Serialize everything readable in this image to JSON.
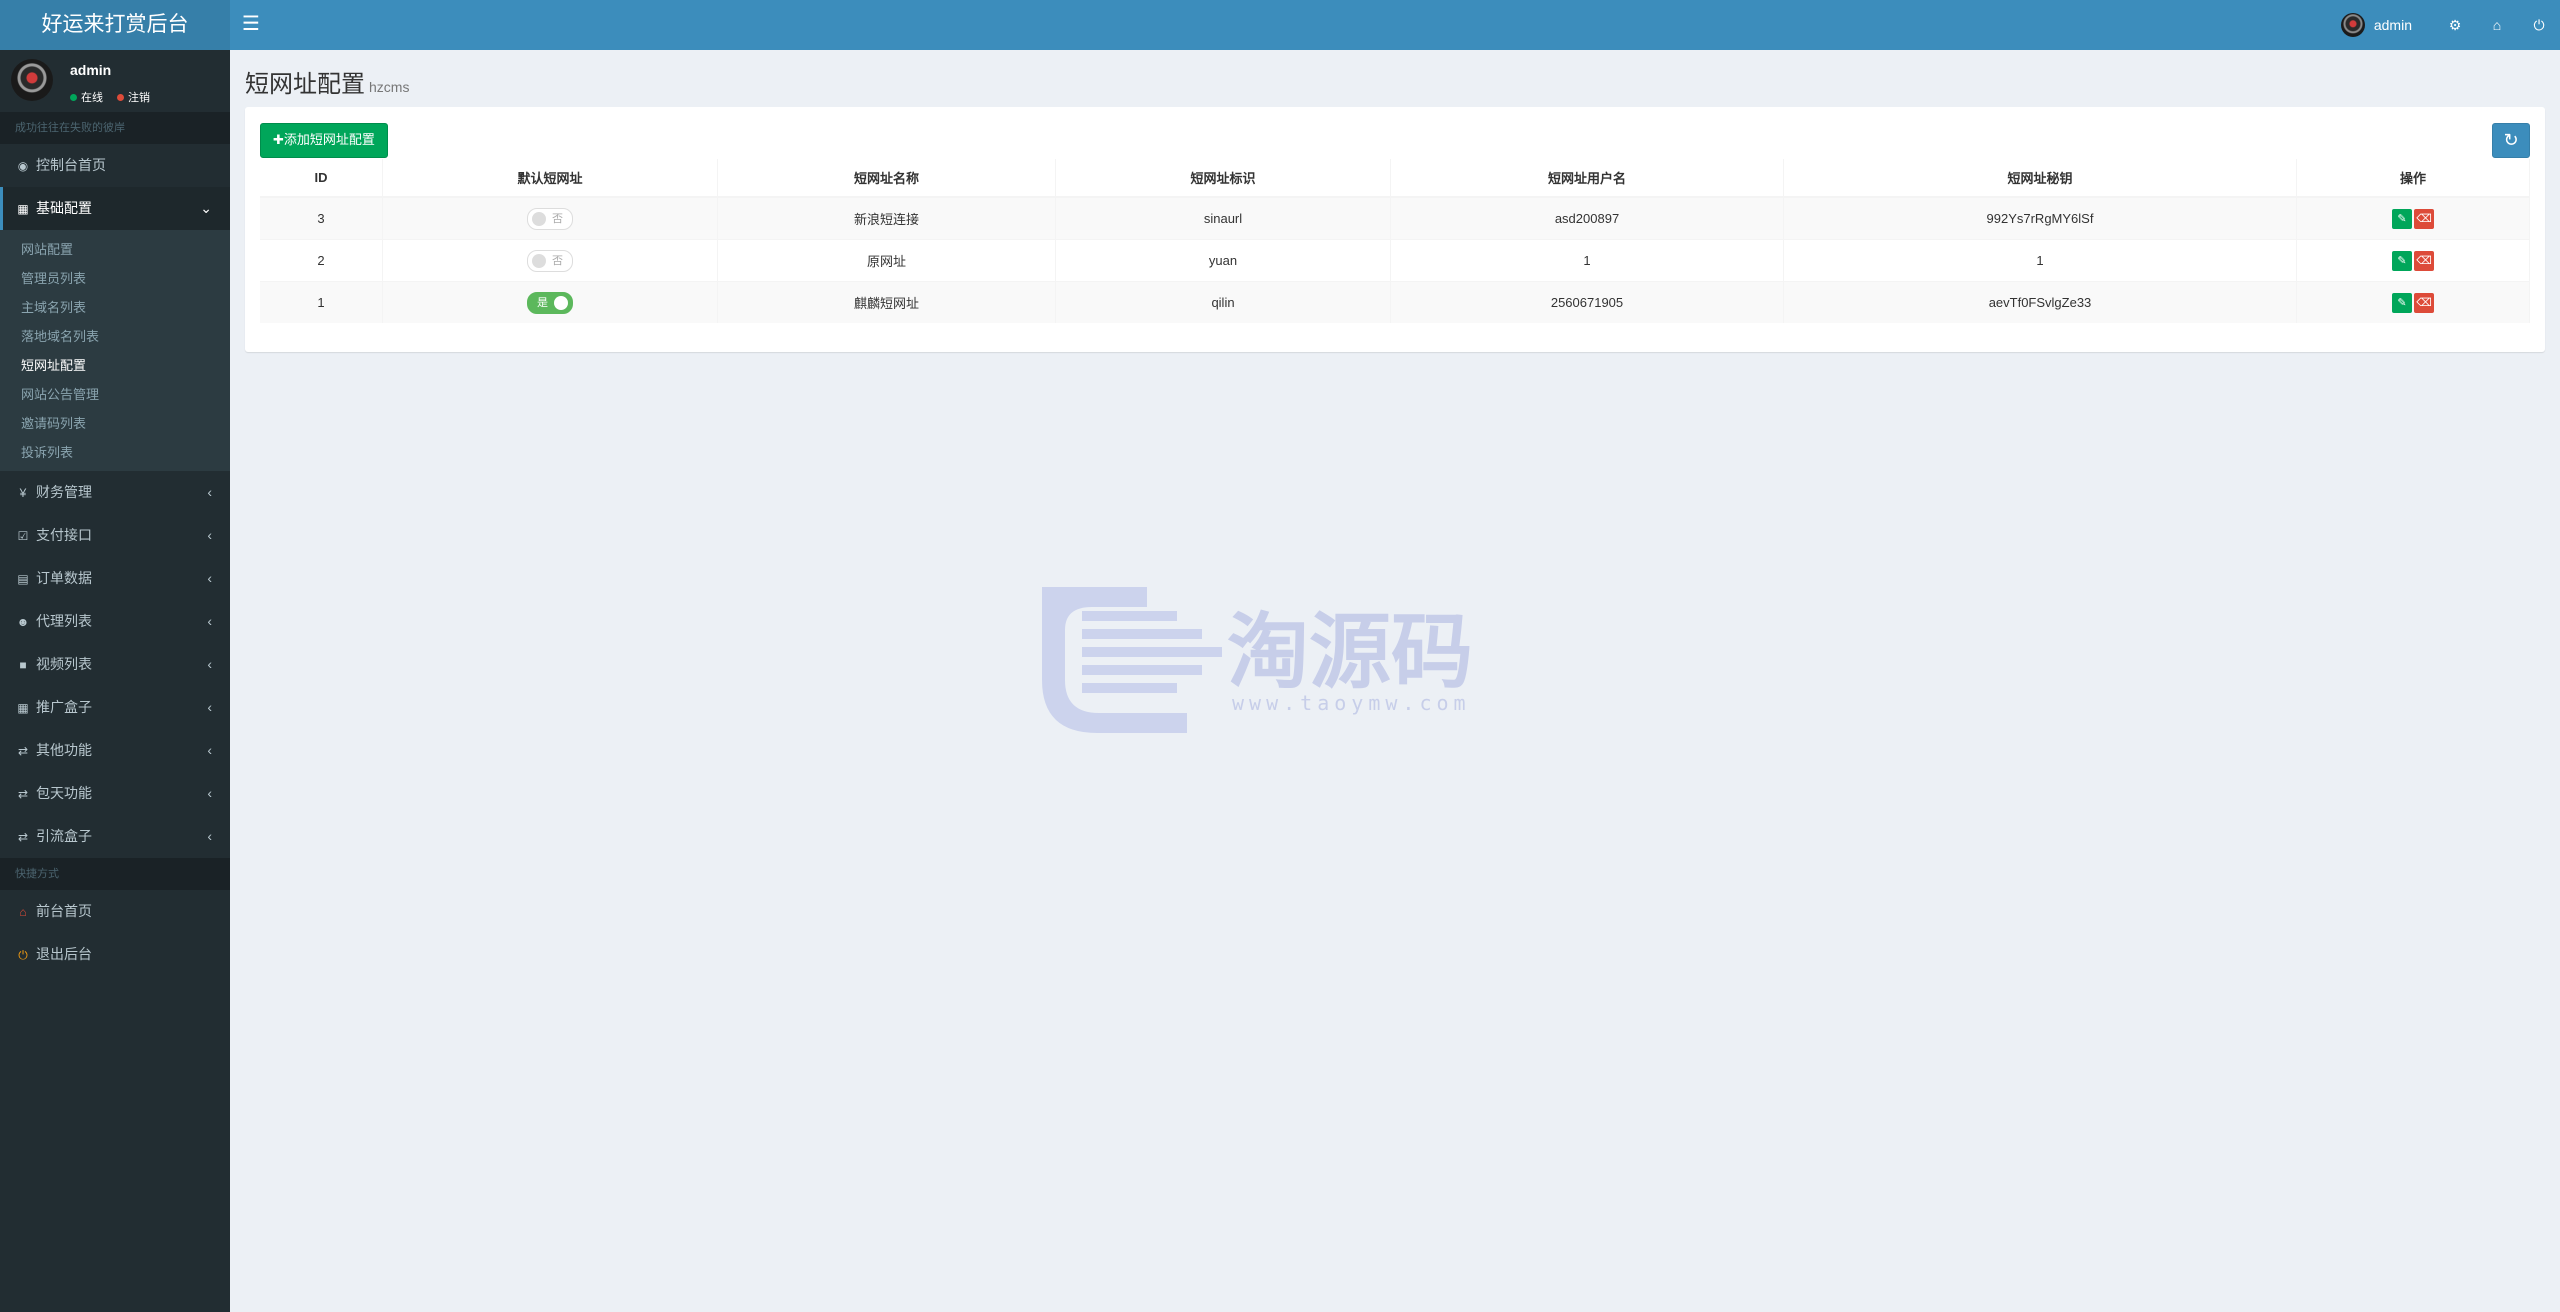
{
  "app": {
    "title": "好运来打赏后台"
  },
  "topbar": {
    "menu_icon": "hamburger-icon",
    "user_name": "admin",
    "icons": [
      "share-icon",
      "home-icon",
      "power-icon"
    ]
  },
  "sidebar": {
    "user": {
      "name": "admin",
      "online": "在线",
      "logout": "注销"
    },
    "header_text": "成功往往在失败的彼岸",
    "dashboard": "控制台首页",
    "basic_config": {
      "label": "基础配置",
      "items": [
        "网站配置",
        "管理员列表",
        "主域名列表",
        "落地域名列表",
        "短网址配置",
        "网站公告管理",
        "邀请码列表",
        "投诉列表"
      ]
    },
    "menus": [
      "财务管理",
      "支付接口",
      "订单数据",
      "代理列表",
      "视频列表",
      "推广盒子",
      "其他功能",
      "包天功能",
      "引流盒子"
    ],
    "shortcut_header": "快捷方式",
    "shortcuts": [
      "前台首页",
      "退出后台"
    ]
  },
  "page": {
    "title": "短网址配置",
    "subtitle": "hzcms"
  },
  "toolbar": {
    "add_label": "添加短网址配置"
  },
  "table": {
    "headers": [
      "ID",
      "默认短网址",
      "短网址名称",
      "短网址标识",
      "短网址用户名",
      "短网址秘钥",
      "操作"
    ],
    "rows": [
      {
        "id": "3",
        "default": "否",
        "name": "新浪短连接",
        "tag": "sinaurl",
        "username": "asd200897",
        "secret": "992Ys7rRgMY6lSf"
      },
      {
        "id": "2",
        "default": "否",
        "name": "原网址",
        "tag": "yuan",
        "username": "1",
        "secret": "1"
      },
      {
        "id": "1",
        "default": "是",
        "name": "麒麟短网址",
        "tag": "qilin",
        "username": "2560671905",
        "secret": "aevTf0FSvlgZe33"
      }
    ]
  },
  "watermark": {
    "text": "淘源码",
    "url": "www.taoymw.com"
  },
  "colors": {
    "primary": "#3c8dbc",
    "sidebar": "#222d32",
    "success": "#00a65a",
    "danger": "#dd4b39"
  }
}
